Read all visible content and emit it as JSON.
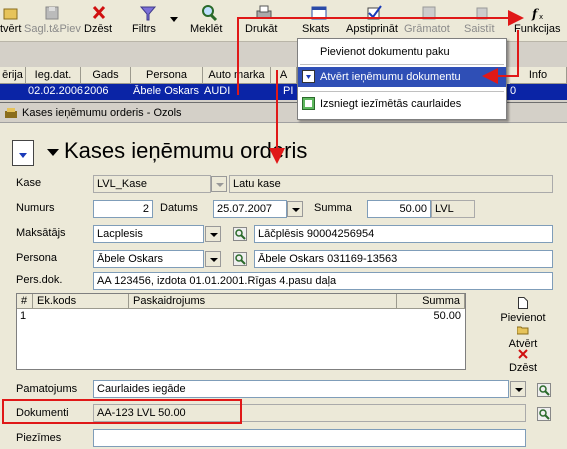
{
  "toolbar": {
    "items": [
      {
        "label": "tvērt",
        "icon": "open-icon"
      },
      {
        "label": "Sagl.t&Piev",
        "icon": "save-add-icon"
      },
      {
        "label": "Dzēst",
        "icon": "delete-icon"
      },
      {
        "label": "Filtrs",
        "icon": "filter-icon"
      },
      {
        "label": "Meklēt",
        "icon": "search-icon"
      },
      {
        "label": "Drukāt",
        "icon": "print-icon"
      },
      {
        "label": "Skats",
        "icon": "view-icon"
      },
      {
        "label": "Apstiprināt",
        "icon": "approve-icon"
      },
      {
        "label": "Grāmatot",
        "icon": "book-icon"
      },
      {
        "label": "Saistīt",
        "icon": "link-icon"
      },
      {
        "label": "Funkcijas",
        "icon": "function-icon"
      }
    ]
  },
  "grid": {
    "headers": [
      "ērija",
      "Ieg.dat.",
      "Gads",
      "Persona",
      "Auto marka",
      "A",
      "Info"
    ],
    "row": {
      "c0": "",
      "c1": "02.02.2006",
      "c2": "2006",
      "c3": "Ābele Oskars",
      "c4": "AUDI",
      "c5": "PI",
      "c6": "0"
    }
  },
  "menu": {
    "items": [
      {
        "label": "Pievienot dokumentu paku",
        "icon": ""
      },
      {
        "label": "Atvērt ieņēmumu dokumentu",
        "icon": "open-document-icon"
      },
      {
        "label": "Izsniegt iezīmētās caurlaides",
        "icon": "issue-pass-icon"
      }
    ]
  },
  "window": {
    "title": "Kases ieņēmumu orderis - Ozols",
    "header_title": "Kases ieņēmumu orderis"
  },
  "form": {
    "kase_label": "Kase",
    "kase_value": "LVL_Kase",
    "kase_name": "Latu kase",
    "numurs_label": "Numurs",
    "numurs_value": "2",
    "datums_label": "Datums",
    "datums_value": "25.07.2007",
    "summa_label": "Summa",
    "summa_value": "50.00",
    "currency": "LVL",
    "maksatajs_label": "Maksātājs",
    "maksatajs_value": "Lacplesis",
    "maksatajs_detail": "Lāčplēsis 90004256954",
    "persona_label": "Persona",
    "persona_value": "Ābele Oskars",
    "persona_detail": "Ābele Oskars 031169-13563",
    "persdok_label": "Pers.dok.",
    "persdok_value": "AA 123456, izdota 01.01.2001.Rīgas 4.pasu daļa",
    "pamatojums_label": "Pamatojums",
    "pamatojums_value": "Caurlaides iegāde",
    "dokumenti_label": "Dokumenti",
    "dokumenti_value": "AA-123 LVL 50.00",
    "piezimes_label": "Piezīmes",
    "piezimes_value": ""
  },
  "lines": {
    "headers": [
      "#",
      "Ek.kods",
      "Paskaidrojums",
      "Summa"
    ],
    "rows": [
      {
        "n": "1",
        "code": "",
        "desc": "",
        "sum": "50.00"
      }
    ]
  },
  "side_buttons": {
    "add": "Pievienot",
    "open": "Atvērt",
    "delete": "Dzēst"
  },
  "colors": {
    "selection": "#0a24a6",
    "menu_highlight": "#2f4fb6",
    "annotation": "#e01818"
  }
}
